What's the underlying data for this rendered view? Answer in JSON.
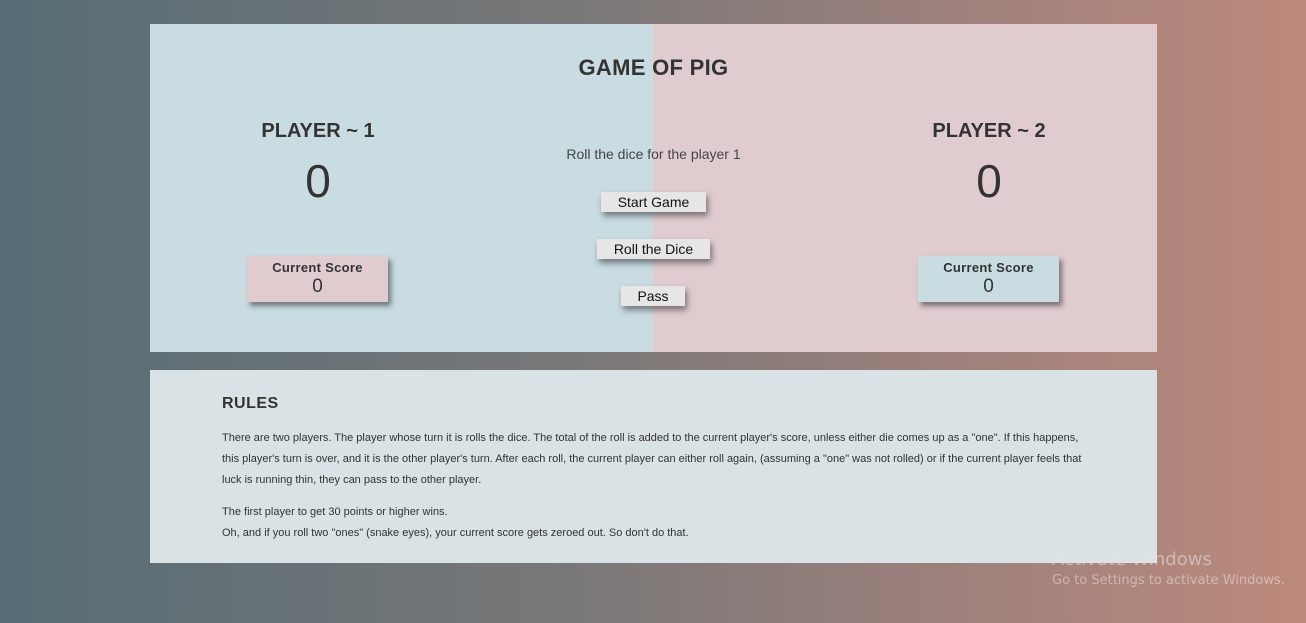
{
  "game": {
    "title": "GAME OF PIG",
    "status": "Roll the dice for the player 1",
    "players": [
      {
        "name": "PLAYER ~ 1",
        "total": "0",
        "current_label": "Current Score",
        "current_value": "0"
      },
      {
        "name": "PLAYER ~ 2",
        "total": "0",
        "current_label": "Current Score",
        "current_value": "0"
      }
    ],
    "buttons": {
      "start": "Start Game",
      "roll": "Roll the Dice",
      "pass": "Pass"
    }
  },
  "rules": {
    "title": "RULES",
    "paragraph1": "There are two players. The player whose turn it is rolls the dice. The total of the roll is added to the current player's score, unless either die comes up as a \"one\". If this happens, this player's turn is over, and it is the other player's turn. After each roll, the current player can either roll again, (assuming a \"one\" was not rolled) or if the current player feels that luck is running thin, they can pass to the other player.",
    "paragraph2": "The first player to get 30 points or higher wins.",
    "paragraph3": "Oh, and if you roll two \"ones\" (snake eyes), your current score gets zeroed out. So don't do that."
  },
  "watermark": {
    "title": "Activate Windows",
    "subtitle": "Go to Settings to activate Windows."
  },
  "colors": {
    "player1_panel": "#c8dce1",
    "player2_panel": "#e0cccf",
    "rules_panel": "#d9e2e5"
  }
}
